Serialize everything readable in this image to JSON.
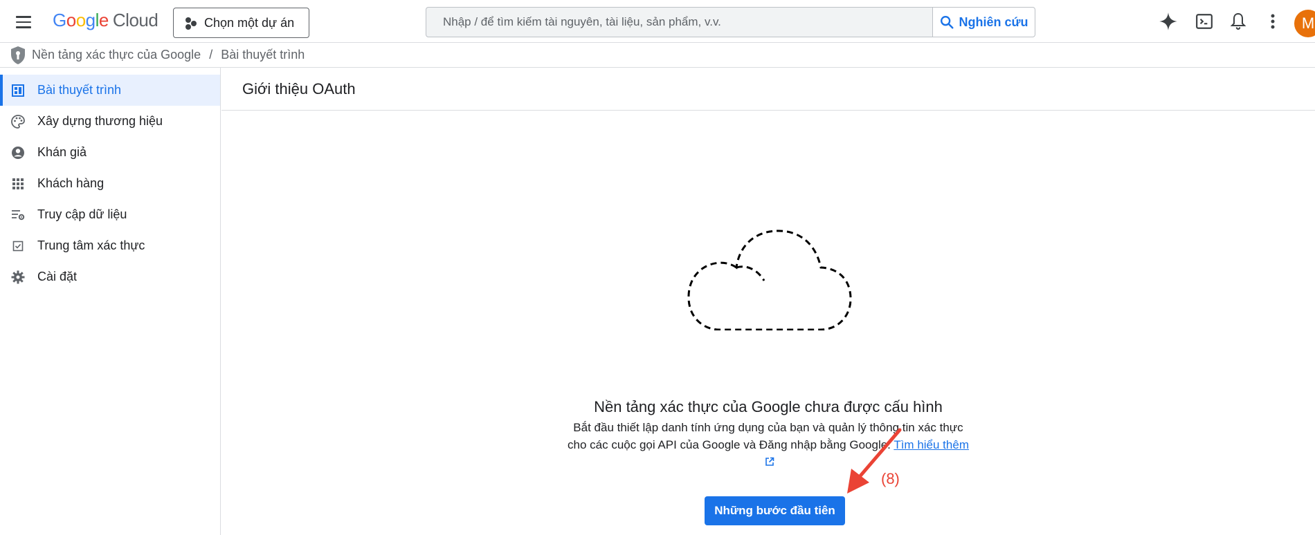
{
  "header": {
    "logo": {
      "g1": "G",
      "g2": "o",
      "g3": "o",
      "g4": "g",
      "g5": "l",
      "g6": "e",
      "cloud": "Cloud"
    },
    "project_button_label": "Chọn một dự án",
    "search": {
      "placeholder": "Nhập / để tìm kiếm tài nguyên, tài liệu, sản phẩm, v.v."
    },
    "search_button_label": "Nghiên cứu",
    "avatar_letter": "M"
  },
  "breadcrumb": {
    "items": [
      "Nền tảng xác thực của Google",
      "Bài thuyết trình"
    ],
    "separator": "/"
  },
  "sidebar": {
    "items": [
      {
        "label": "Bài thuyết trình",
        "icon": "dashboard-icon",
        "active": true
      },
      {
        "label": "Xây dựng thương hiệu",
        "icon": "palette-icon"
      },
      {
        "label": "Khán giả",
        "icon": "account-circle-icon"
      },
      {
        "label": "Khách hàng",
        "icon": "apps-grid-icon"
      },
      {
        "label": "Truy cập dữ liệu",
        "icon": "list-settings-icon"
      },
      {
        "label": "Trung tâm xác thực",
        "icon": "checkbox-icon"
      },
      {
        "label": "Cài đặt",
        "icon": "gear-icon"
      }
    ]
  },
  "main": {
    "title": "Giới thiệu OAuth",
    "empty_state": {
      "title": "Nền tảng xác thực của Google chưa được cấu hình",
      "description": "Bắt đầu thiết lập danh tính ứng dụng của bạn và quản lý thông tin xác thực cho các cuộc gọi API của Google và Đăng nhập bằng Google.",
      "link_label": "Tìm hiểu thêm",
      "button_label": "Những bước đầu tiên"
    },
    "annotation_label": "(8)"
  },
  "colors": {
    "accent": "#1a73e8",
    "annotation": "#ea4335",
    "avatar": "#e8710a"
  }
}
